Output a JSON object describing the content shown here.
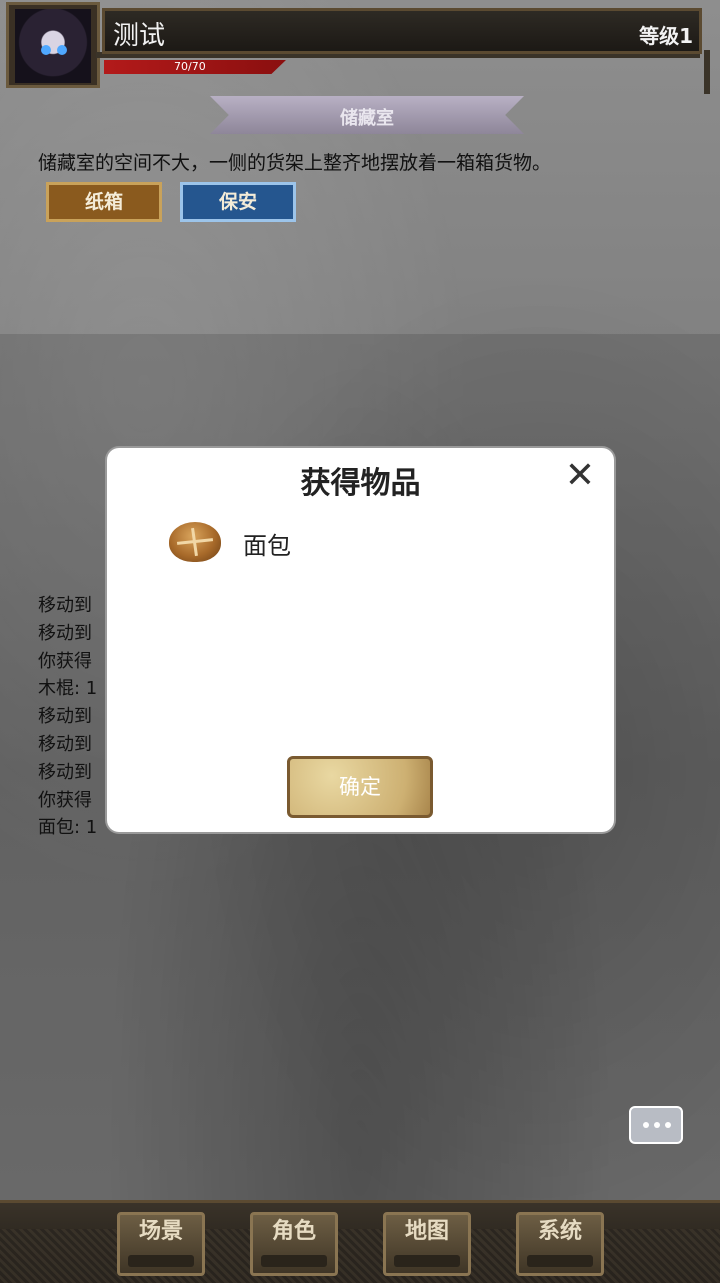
{
  "header": {
    "player_name": "测试",
    "level": "等级1",
    "hp": "70/70"
  },
  "scene": {
    "title": "储藏室",
    "description": "储藏室的空间不大，一侧的货架上整齐地摆放着一箱箱货物。",
    "actions": [
      "纸箱",
      "保安"
    ]
  },
  "log": [
    "移动到",
    "移动到",
    "你获得",
    "木棍: 1",
    "移动到",
    "移动到",
    "移动到",
    "你获得",
    "面包: 1"
  ],
  "modal": {
    "title": "获得物品",
    "close_icon": "close-icon",
    "item": {
      "icon": "bread-icon",
      "name": "面包"
    },
    "confirm_label": "确定"
  },
  "nav": [
    "场景",
    "角色",
    "地图",
    "系统"
  ]
}
